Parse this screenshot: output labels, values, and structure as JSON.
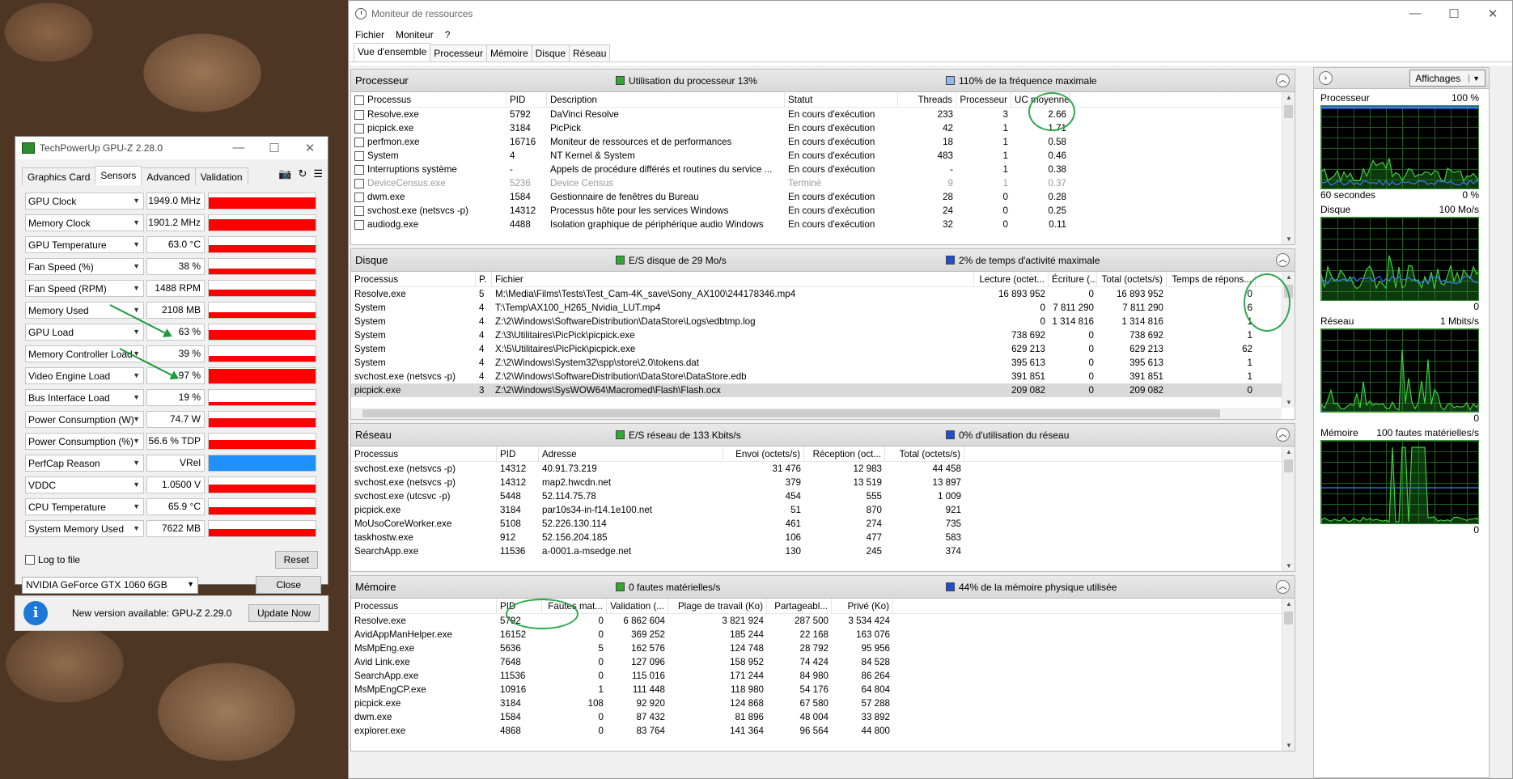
{
  "gpuz": {
    "title": "TechPowerUp GPU-Z 2.28.0",
    "tabs": [
      "Graphics Card",
      "Sensors",
      "Advanced",
      "Validation"
    ],
    "sensors": [
      {
        "name": "GPU Clock",
        "value": "1949.0 MHz",
        "level": 0.75,
        "color": "red"
      },
      {
        "name": "Memory Clock",
        "value": "1901.2 MHz",
        "level": 0.75,
        "color": "red"
      },
      {
        "name": "GPU Temperature",
        "value": "63.0 °C",
        "level": 0.5,
        "color": "red"
      },
      {
        "name": "Fan Speed (%)",
        "value": "38 %",
        "level": 0.38,
        "color": "red"
      },
      {
        "name": "Fan Speed (RPM)",
        "value": "1488 RPM",
        "level": 0.4,
        "color": "red"
      },
      {
        "name": "Memory Used",
        "value": "2108 MB",
        "level": 0.35,
        "color": "red"
      },
      {
        "name": "GPU Load",
        "value": "63 %",
        "level": 0.63,
        "color": "red"
      },
      {
        "name": "Memory Controller Load",
        "value": "39 %",
        "level": 0.39,
        "color": "red"
      },
      {
        "name": "Video Engine Load",
        "value": "97 %",
        "level": 0.97,
        "color": "red"
      },
      {
        "name": "Bus Interface Load",
        "value": "19 %",
        "level": 0.19,
        "color": "red"
      },
      {
        "name": "Power Consumption (W)",
        "value": "74.7 W",
        "level": 0.6,
        "color": "red"
      },
      {
        "name": "Power Consumption (%)",
        "value": "56.6 % TDP",
        "level": 0.57,
        "color": "red"
      },
      {
        "name": "PerfCap Reason",
        "value": "VRel",
        "level": 1.0,
        "color": "blue"
      },
      {
        "name": "VDDC",
        "value": "1.0500 V",
        "level": 0.55,
        "color": "red"
      },
      {
        "name": "CPU Temperature",
        "value": "65.9 °C",
        "level": 0.5,
        "color": "red"
      },
      {
        "name": "System Memory Used",
        "value": "7622 MB",
        "level": 0.45,
        "color": "red"
      }
    ],
    "log_label": "Log to file",
    "reset_label": "Reset",
    "card": "NVIDIA GeForce GTX 1060 6GB",
    "close_label": "Close",
    "notify": "New version available: GPU-Z 2.29.0",
    "update_label": "Update Now"
  },
  "rm": {
    "title": "Moniteur de ressources",
    "menu": [
      "Fichier",
      "Moniteur",
      "?"
    ],
    "tabs": [
      "Vue d'ensemble",
      "Processeur",
      "Mémoire",
      "Disque",
      "Réseau"
    ],
    "cpu": {
      "title": "Processeur",
      "m1": "Utilisation du processeur 13%",
      "m2": "110% de la fréquence maximale",
      "headers": [
        "Processus",
        "PID",
        "Description",
        "Statut",
        "Threads",
        "Processeur",
        "UC moyenne"
      ],
      "rows": [
        [
          "Resolve.exe",
          "5792",
          "DaVinci Resolve",
          "En cours d'exécution",
          "233",
          "3",
          "2.66"
        ],
        [
          "picpick.exe",
          "3184",
          "PicPick",
          "En cours d'exécution",
          "42",
          "1",
          "1.71"
        ],
        [
          "perfmon.exe",
          "16716",
          "Moniteur de ressources et de performances",
          "En cours d'exécution",
          "18",
          "1",
          "0.58"
        ],
        [
          "System",
          "4",
          "NT Kernel & System",
          "En cours d'exécution",
          "483",
          "1",
          "0.46"
        ],
        [
          "Interruptions système",
          "-",
          "Appels de procédure différés et routines du service ...",
          "En cours d'exécution",
          "-",
          "1",
          "0.38"
        ],
        [
          "DeviceCensus.exe",
          "5236",
          "Device Census",
          "Terminé",
          "9",
          "1",
          "0.37"
        ],
        [
          "dwm.exe",
          "1584",
          "Gestionnaire de fenêtres du Bureau",
          "En cours d'exécution",
          "28",
          "0",
          "0.28"
        ],
        [
          "svchost.exe (netsvcs -p)",
          "14312",
          "Processus hôte pour les services Windows",
          "En cours d'exécution",
          "24",
          "0",
          "0.25"
        ],
        [
          "audiodg.exe",
          "4488",
          "Isolation graphique de périphérique audio Windows",
          "En cours d'exécution",
          "32",
          "0",
          "0.11"
        ]
      ]
    },
    "disk": {
      "title": "Disque",
      "m1": "E/S disque de 29 Mo/s",
      "m2": "2% de temps d'activité maximale",
      "headers": [
        "Processus",
        "P.",
        "Fichier",
        "Lecture (octet...",
        "Écriture (...",
        "Total (octets/s)",
        "Temps de répons..."
      ],
      "rows": [
        [
          "Resolve.exe",
          "5",
          "M:\\Media\\Films\\Tests\\Test_Cam-4K_save\\Sony_AX100\\244178346.mp4",
          "16 893 952",
          "0",
          "16 893 952",
          "0"
        ],
        [
          "System",
          "4",
          "T:\\Temp\\AX100_H265_Nvidia_LUT.mp4",
          "0",
          "7 811 290",
          "7 811 290",
          "6"
        ],
        [
          "System",
          "4",
          "Z:\\2\\Windows\\SoftwareDistribution\\DataStore\\Logs\\edbtmp.log",
          "0",
          "1 314 816",
          "1 314 816",
          "1"
        ],
        [
          "System",
          "4",
          "Z:\\3\\Utilitaires\\PicPick\\picpick.exe",
          "738 692",
          "0",
          "738 692",
          "1"
        ],
        [
          "System",
          "4",
          "X:\\5\\Utilitaires\\PicPick\\picpick.exe",
          "629 213",
          "0",
          "629 213",
          "62"
        ],
        [
          "System",
          "4",
          "Z:\\2\\Windows\\System32\\spp\\store\\2.0\\tokens.dat",
          "395 613",
          "0",
          "395 613",
          "1"
        ],
        [
          "svchost.exe (netsvcs -p)",
          "4",
          "Z:\\2\\Windows\\SoftwareDistribution\\DataStore\\DataStore.edb",
          "391 851",
          "0",
          "391 851",
          "1"
        ],
        [
          "picpick.exe",
          "3",
          "Z:\\2\\Windows\\SysWOW64\\Macromed\\Flash\\Flash.ocx",
          "209 082",
          "0",
          "209 082",
          "0"
        ]
      ]
    },
    "net": {
      "title": "Réseau",
      "m1": "E/S réseau de 133 Kbits/s",
      "m2": "0% d'utilisation du réseau",
      "headers": [
        "Processus",
        "PID",
        "Adresse",
        "Envoi (octets/s)",
        "Réception (oct...",
        "Total (octets/s)"
      ],
      "rows": [
        [
          "svchost.exe (netsvcs -p)",
          "14312",
          "40.91.73.219",
          "31 476",
          "12 983",
          "44 458"
        ],
        [
          "svchost.exe (netsvcs -p)",
          "14312",
          "map2.hwcdn.net",
          "379",
          "13 519",
          "13 897"
        ],
        [
          "svchost.exe (utcsvc -p)",
          "5448",
          "52.114.75.78",
          "454",
          "555",
          "1 009"
        ],
        [
          "picpick.exe",
          "3184",
          "par10s34-in-f14.1e100.net",
          "51",
          "870",
          "921"
        ],
        [
          "MoUsoCoreWorker.exe",
          "5108",
          "52.226.130.114",
          "461",
          "274",
          "735"
        ],
        [
          "taskhostw.exe",
          "912",
          "52.156.204.185",
          "106",
          "477",
          "583"
        ],
        [
          "SearchApp.exe",
          "11536",
          "a-0001.a-msedge.net",
          "130",
          "245",
          "374"
        ]
      ]
    },
    "mem": {
      "title": "Mémoire",
      "m1": "0 fautes matérielles/s",
      "m2": "44% de la mémoire physique utilisée",
      "headers": [
        "Processus",
        "PID",
        "Fautes mat...",
        "Validation (...",
        "Plage de travail (Ko)",
        "Partageabl...",
        "Privé (Ko)"
      ],
      "rows": [
        [
          "Resolve.exe",
          "5792",
          "0",
          "6 862 604",
          "3 821 924",
          "287 500",
          "3 534 424"
        ],
        [
          "AvidAppManHelper.exe",
          "16152",
          "0",
          "369 252",
          "185 244",
          "22 168",
          "163 076"
        ],
        [
          "MsMpEng.exe",
          "5636",
          "5",
          "162 576",
          "124 748",
          "28 792",
          "95 956"
        ],
        [
          "Avid Link.exe",
          "7648",
          "0",
          "127 096",
          "158 952",
          "74 424",
          "84 528"
        ],
        [
          "SearchApp.exe",
          "11536",
          "0",
          "115 016",
          "171 244",
          "84 980",
          "86 264"
        ],
        [
          "MsMpEngCP.exe",
          "10916",
          "1",
          "111 448",
          "118 980",
          "54 176",
          "64 804"
        ],
        [
          "picpick.exe",
          "3184",
          "108",
          "92 920",
          "124 868",
          "67 580",
          "57 288"
        ],
        [
          "dwm.exe",
          "1584",
          "0",
          "87 432",
          "81 896",
          "48 004",
          "33 892"
        ],
        [
          "explorer.exe",
          "4868",
          "0",
          "83 764",
          "141 364",
          "96 564",
          "44 800"
        ]
      ]
    },
    "panel": {
      "views_label": "Affichages",
      "graphs": [
        {
          "name": "Processeur",
          "max": "100 %",
          "foot_l": "60 secondes",
          "foot_r": "0 %"
        },
        {
          "name": "Disque",
          "max": "100 Mo/s",
          "foot_l": "",
          "foot_r": "0"
        },
        {
          "name": "Réseau",
          "max": "1 Mbits/s",
          "foot_l": "",
          "foot_r": "0"
        },
        {
          "name": "Mémoire",
          "max": "100 fautes matérielles/s",
          "foot_l": "",
          "foot_r": "0"
        }
      ]
    }
  },
  "colors": {
    "graph_red": "#ff0000",
    "graph_blue": "#1e90ff",
    "rm_green": "#2ea82e",
    "rm_blue": "#1f4fd0",
    "annot_green": "#2ea84e"
  }
}
